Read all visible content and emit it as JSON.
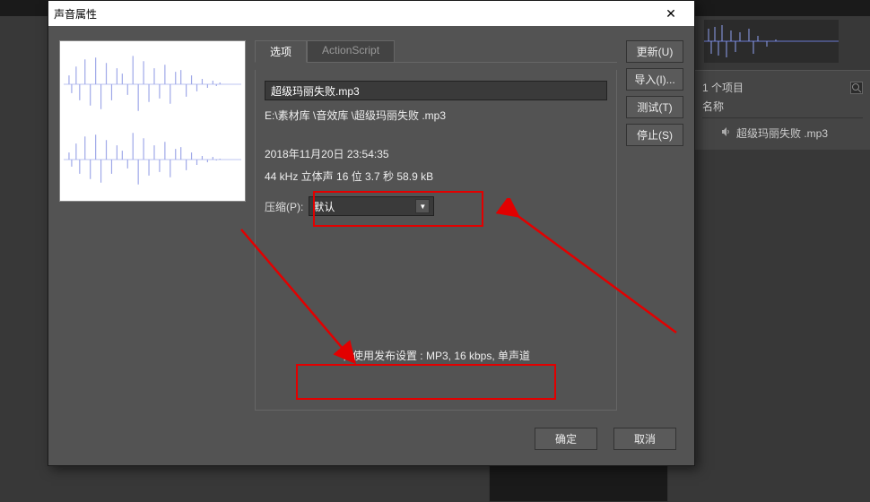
{
  "dialog": {
    "title": "声音属性",
    "close_label": "✕",
    "filename": "超级玛丽失败.mp3",
    "filepath": "E:\\素材库 \\音效库 \\超级玛丽失败 .mp3",
    "datetime": "2018年11月20日  23:54:35",
    "audio_info": "44 kHz  立体声  16 位  3.7 秒 58.9 kB",
    "compression_label": "压缩(P):",
    "compression_value": "默认",
    "publish_msg": "将使用发布设置 : MP3, 16 kbps, 单声道",
    "tabs": [
      {
        "label": "选项",
        "active": true
      },
      {
        "label": "ActionScript",
        "active": false
      }
    ],
    "buttons": {
      "update": "更新(U)",
      "import": "导入(I)...",
      "test": "测试(T)",
      "stop": "停止(S)",
      "ok": "确定",
      "cancel": "取消"
    }
  },
  "bg": {
    "project_count": "1 个项目",
    "col_name": "名称",
    "item_name": "超级玛丽失败 .mp3"
  },
  "colors": {
    "red": "#e20000",
    "wave": "#9fa8e8"
  }
}
